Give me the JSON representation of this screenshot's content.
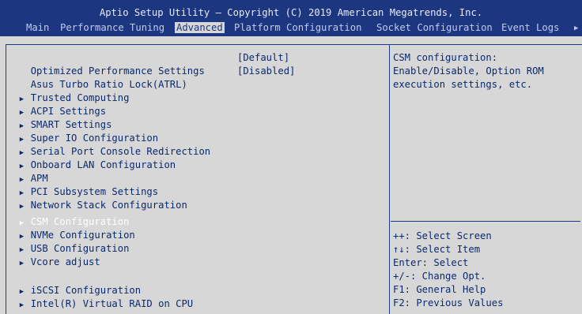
{
  "header": {
    "title": "Aptio Setup Utility – Copyright (C) 2019 American Megatrends, Inc.",
    "tabs": [
      {
        "label": "Main",
        "active": false
      },
      {
        "label": "Performance Tuning",
        "active": false
      },
      {
        "label": "Advanced",
        "active": true
      },
      {
        "label": "Platform Configuration",
        "active": false
      },
      {
        "label": "Socket Configuration",
        "active": false
      },
      {
        "label": "Event Logs",
        "active": false
      }
    ],
    "more_icon": "triangle-right-icon"
  },
  "menu": {
    "items": [
      {
        "label": "Optimized Performance Settings",
        "value": "[Default]",
        "submenu": false
      },
      {
        "label": "Asus Turbo Ratio Lock(ATRL)",
        "value": "[Disabled]",
        "submenu": false
      },
      {
        "label": "Trusted Computing",
        "submenu": true
      },
      {
        "label": "ACPI Settings",
        "submenu": true
      },
      {
        "label": "SMART Settings",
        "submenu": true
      },
      {
        "label": "Super IO Configuration",
        "submenu": true
      },
      {
        "label": "Serial Port Console Redirection",
        "submenu": true
      },
      {
        "label": "Onboard LAN Configuration",
        "submenu": true
      },
      {
        "label": "APM",
        "submenu": true
      },
      {
        "label": "PCI Subsystem Settings",
        "submenu": true
      },
      {
        "label": "Network Stack Configuration",
        "submenu": true
      },
      {
        "label": "CSM Configuration",
        "submenu": true,
        "selected": true
      },
      {
        "label": "NVMe Configuration",
        "submenu": true
      },
      {
        "label": "USB Configuration",
        "submenu": true
      },
      {
        "label": "Vcore adjust",
        "submenu": true
      },
      {
        "label": "iSCSI Configuration",
        "submenu": true
      },
      {
        "label": "Intel(R) Virtual RAID on CPU",
        "submenu": true
      }
    ]
  },
  "help_panel": {
    "description": [
      "CSM configuration:",
      "Enable/Disable, Option ROM",
      "execution settings, etc."
    ],
    "keys": [
      "++: Select Screen",
      "↑↓: Select Item",
      "Enter: Select",
      "+/-: Change Opt.",
      "F1: General Help",
      "F2: Previous Values"
    ]
  },
  "colors": {
    "header_bg": "#1c3680",
    "body_bg": "#d7d7d7",
    "text": "#0a2a6e",
    "selected_text": "#ffffff"
  }
}
